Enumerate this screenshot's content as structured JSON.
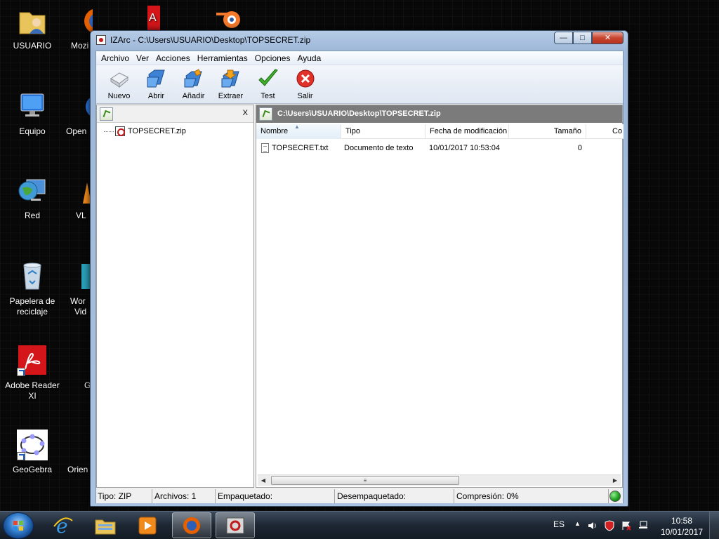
{
  "desktop": {
    "icons": [
      {
        "label": "USUARIO"
      },
      {
        "label": "Equipo"
      },
      {
        "label": "Red"
      },
      {
        "label": "Papelera de reciclaje"
      },
      {
        "label": "Adobe Reader XI"
      },
      {
        "label": "GeoGebra"
      }
    ],
    "partial_icons": [
      {
        "label": "Mozi"
      },
      {
        "label": "Open"
      },
      {
        "label": "VL"
      },
      {
        "label": "Wor"
      },
      {
        "label": "Vid"
      },
      {
        "label": "G"
      },
      {
        "label": "Orien"
      }
    ]
  },
  "window": {
    "title": "IZArc - C:\\Users\\USUARIO\\Desktop\\TOPSECRET.zip",
    "menu": [
      "Archivo",
      "Ver",
      "Acciones",
      "Herramientas",
      "Opciones",
      "Ayuda"
    ],
    "toolbar": {
      "nuevo": "Nuevo",
      "abrir": "Abrir",
      "anadir": "Añadir",
      "extraer": "Extraer",
      "test": "Test",
      "salir": "Salir"
    },
    "left_pane": {
      "close_label": "X",
      "tree_item": "TOPSECRET.zip"
    },
    "right_pane": {
      "path": "C:\\Users\\USUARIO\\Desktop\\TOPSECRET.zip",
      "columns": {
        "nombre": "Nombre",
        "tipo": "Tipo",
        "fecha": "Fecha de modificación",
        "tamano": "Tamaño",
        "comp": "Co"
      },
      "rows": [
        {
          "nombre": "TOPSECRET.txt",
          "tipo": "Documento de texto",
          "fecha": "10/01/2017 10:53:04",
          "tamano": "0"
        }
      ]
    },
    "status": {
      "tipo": "Tipo: ZIP",
      "archivos": "Archivos: 1",
      "empaquetado": "Empaquetado:",
      "desempaquetado": "Desempaquetado:",
      "compresion": "Compresión: 0%"
    }
  },
  "taskbar": {
    "lang": "ES",
    "time": "10:58",
    "date": "10/01/2017"
  },
  "colors": {
    "accent": "#1a5fc7",
    "path_bar": "#7b7b7b",
    "status_ok": "#1a9a1a"
  }
}
